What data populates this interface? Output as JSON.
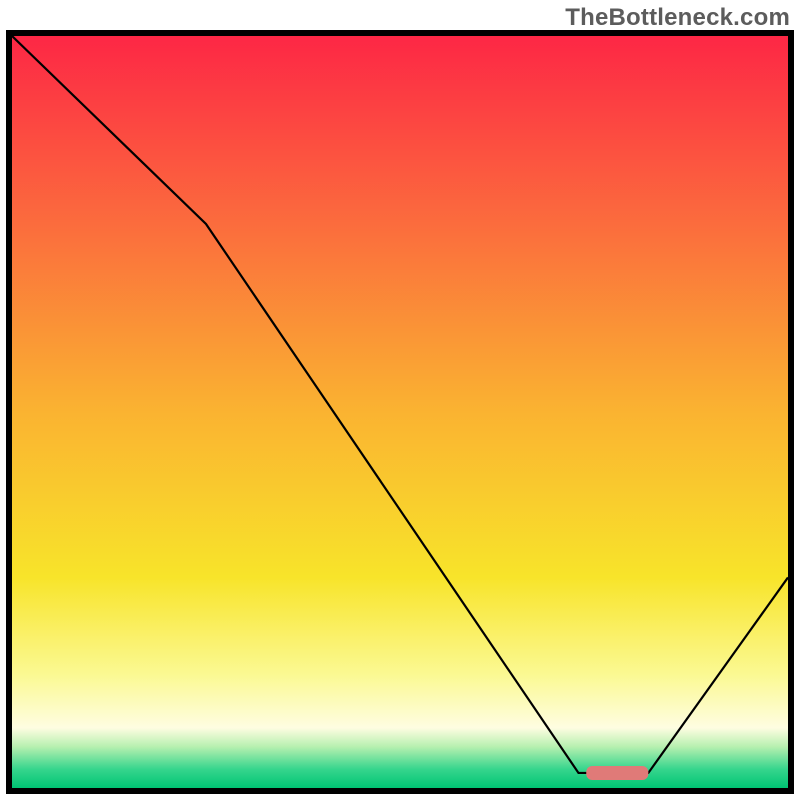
{
  "watermark": "TheBottleneck.com",
  "chart_data": {
    "type": "line",
    "title": "",
    "xlabel": "",
    "ylabel": "",
    "xlim": [
      0,
      100
    ],
    "ylim": [
      0,
      100
    ],
    "series": [
      {
        "name": "bottleneck-curve",
        "x": [
          0,
          25,
          73,
          82,
          100
        ],
        "y": [
          100,
          75,
          2,
          2,
          28
        ]
      }
    ],
    "marker": {
      "name": "optimal-range-marker",
      "x_start": 74,
      "x_end": 82,
      "y": 2
    },
    "background": {
      "description": "vertical gradient red→orange→yellow→pale-yellow→green representing bottleneck severity from top (bad) to bottom (good)",
      "stops": [
        {
          "pos": 0.0,
          "color": "#fd2745"
        },
        {
          "pos": 0.25,
          "color": "#fb6c3d"
        },
        {
          "pos": 0.5,
          "color": "#fab331"
        },
        {
          "pos": 0.72,
          "color": "#f8e42a"
        },
        {
          "pos": 0.85,
          "color": "#fbf993"
        },
        {
          "pos": 0.92,
          "color": "#fefde1"
        },
        {
          "pos": 0.945,
          "color": "#b7f0b0"
        },
        {
          "pos": 0.975,
          "color": "#36d58d"
        },
        {
          "pos": 1.0,
          "color": "#00c574"
        }
      ]
    }
  }
}
